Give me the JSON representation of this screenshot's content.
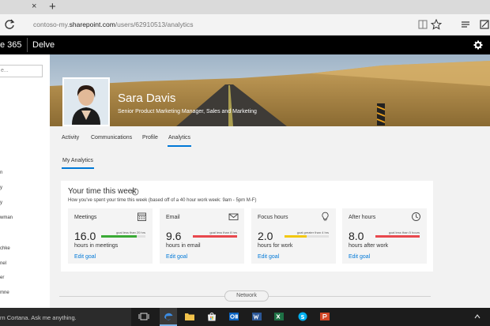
{
  "browser": {
    "tab_close": "×",
    "new_tab": "+",
    "url_prefix": "contoso-my.",
    "url_domain": "sharepoint.com",
    "url_path": "/users/62910513/analytics"
  },
  "office_bar": {
    "suite_name": "e 365",
    "app_name": "Delve"
  },
  "left_panel": {
    "search_placeholder": "e...",
    "items": [
      "n",
      "y",
      "y",
      "wman",
      "chke",
      "nel",
      "er",
      "mne"
    ]
  },
  "profile": {
    "name": "Sara Davis",
    "title": "Senior Product Marketing Manager, Sales and Marketing"
  },
  "tabs": [
    "Activity",
    "Communications",
    "Profile",
    "Analytics"
  ],
  "active_tab": "Analytics",
  "sub_tab": "My Analytics",
  "time_card": {
    "title": "Your time this week",
    "subtitle": "How you've spent your time this week (based off of a 40 hour work week: 9am - 5pm M-F)",
    "tiles": [
      {
        "name": "Meetings",
        "icon": "calendar-icon",
        "goal": "goal less than 20 hrs",
        "value": "16.0",
        "unit": "hours in meetings",
        "edit": "Edit goal",
        "fill": 0.8,
        "color": "#3aaa35"
      },
      {
        "name": "Email",
        "icon": "envelope-icon",
        "goal": "goal less than 8 hrs",
        "value": "9.6",
        "unit": "hours in email",
        "edit": "Edit goal",
        "fill": 1.0,
        "color": "#e8484d"
      },
      {
        "name": "Focus hours",
        "icon": "lightbulb-icon",
        "goal": "goal greater than 4 hrs",
        "value": "2.0",
        "unit": "hours for work",
        "edit": "Edit goal",
        "fill": 0.5,
        "color": "#f2c811"
      },
      {
        "name": "After hours",
        "icon": "clock-icon",
        "goal": "goal less than 5 hours",
        "value": "8.0",
        "unit": "hours after work",
        "edit": "Edit goal",
        "fill": 1.0,
        "color": "#e8484d"
      }
    ]
  },
  "network_label": "Network",
  "taskbar": {
    "cortana_text": "rn Cortana. Ask me anything."
  }
}
